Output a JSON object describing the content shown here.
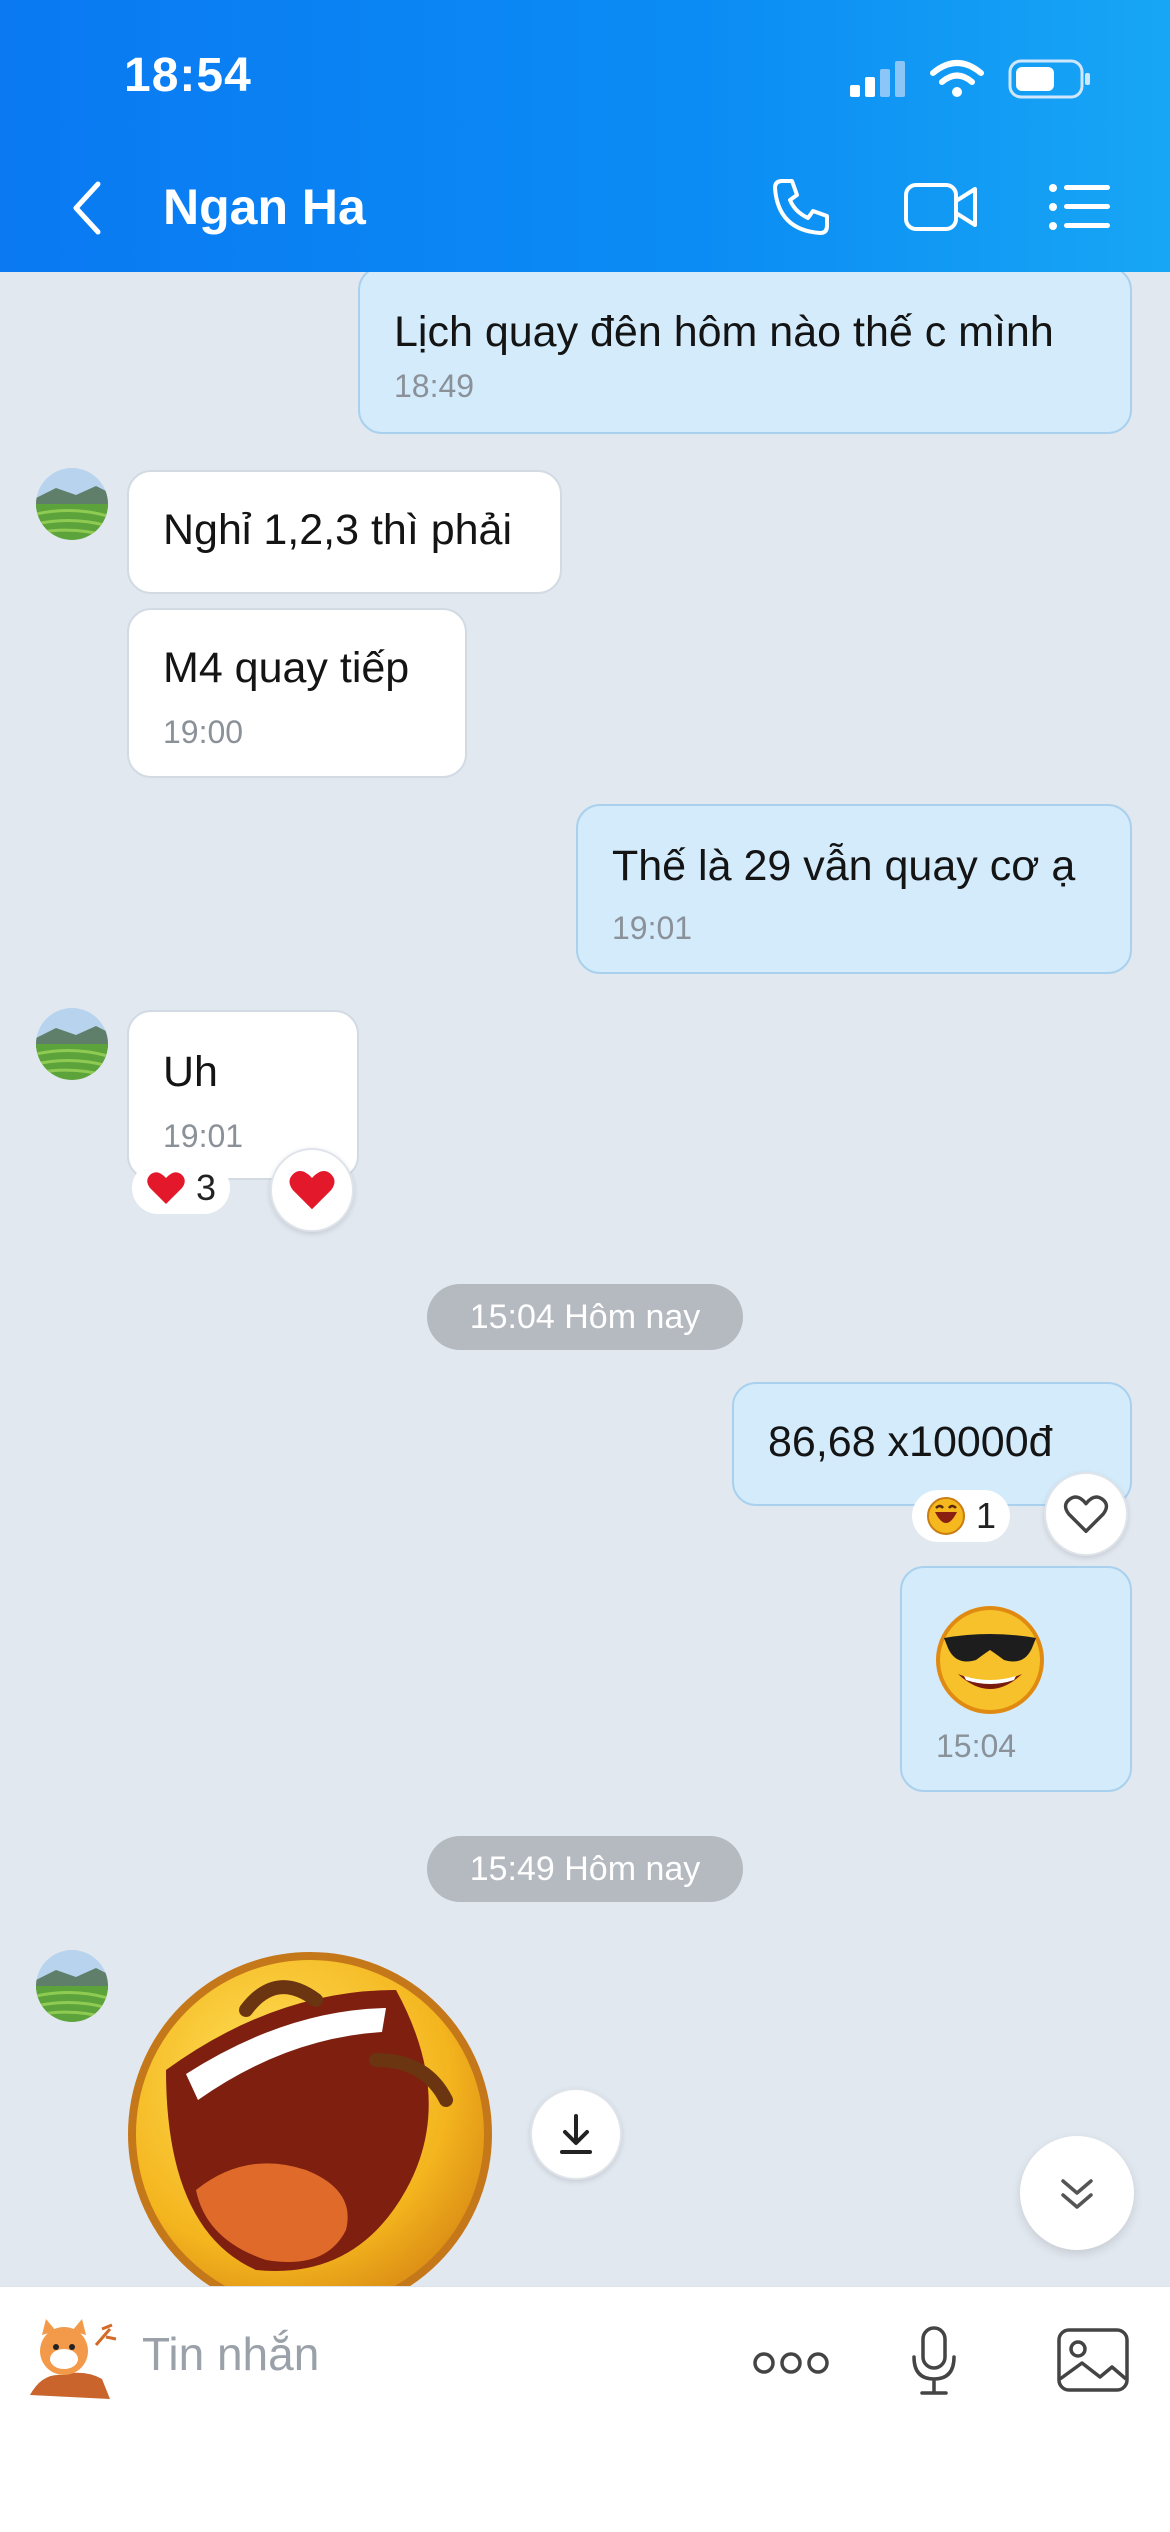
{
  "status_bar": {
    "time": "18:54"
  },
  "header": {
    "contact_name": "Ngan Ha"
  },
  "messages": {
    "m1": {
      "text": "Lịch quay đên hôm nào thế c mình",
      "time": "18:49"
    },
    "m2": {
      "text": "Nghỉ 1,2,3 thì phải"
    },
    "m3": {
      "text": "M4 quay tiếp",
      "time": "19:00"
    },
    "m4": {
      "text": "Thế là 29 vẫn quay cơ ạ",
      "time": "19:01"
    },
    "m5": {
      "text": "Uh",
      "time": "19:01",
      "reaction_count": "3"
    },
    "m6": {
      "text": "86,68  x10000đ",
      "reaction_count": "1"
    },
    "m7": {
      "time": "15:04"
    }
  },
  "dividers": {
    "d1": "15:04 Hôm nay",
    "d2": "15:49 Hôm nay"
  },
  "composer": {
    "placeholder": "Tin nhắn"
  },
  "icons": {
    "back": "chevron-left-icon",
    "call": "phone-icon",
    "video": "video-camera-icon",
    "menu": "list-icon",
    "more": "more-dots-icon",
    "mic": "microphone-icon",
    "image": "image-icon",
    "download": "download-icon",
    "scroll_down": "chevrons-down-icon"
  },
  "colors": {
    "header": "#0a79f2",
    "bubble_out": "#d3ebfb",
    "bubble_in": "#ffffff",
    "chat_bg": "#e2e8f0"
  }
}
